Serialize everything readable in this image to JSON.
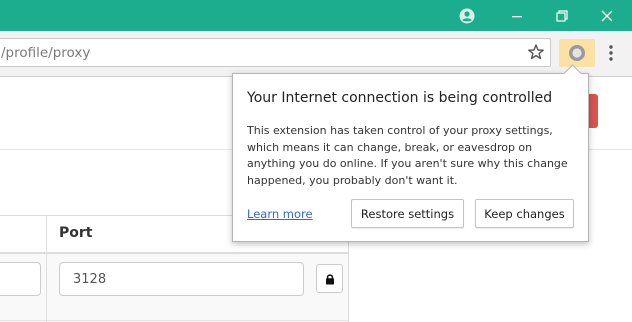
{
  "browser": {
    "colors": {
      "titlebar": "#1bad8d",
      "extension_highlight": "#fbe1a4",
      "danger_button": "#d9534f",
      "link": "#3367d6"
    },
    "titlebar_icons": [
      "profile-icon",
      "minimize-icon",
      "restore-icon",
      "close-icon"
    ],
    "address_bar": {
      "url": "/profile/proxy"
    },
    "toolbar_icons": [
      "star-icon",
      "proxy-extension-icon",
      "more-menu-icon"
    ]
  },
  "page": {
    "table": {
      "column_header": "Port",
      "port_value": "3128",
      "row_action_icon": "lock-icon"
    }
  },
  "popup": {
    "title": "Your Internet connection is being controlled",
    "body": "This extension has taken control of your proxy settings, which means it can change, break, or eavesdrop on anything you do online. If you aren't sure why this change happened, you probably don't want it.",
    "learn_more": "Learn more",
    "restore_button": "Restore settings",
    "keep_button": "Keep changes"
  }
}
